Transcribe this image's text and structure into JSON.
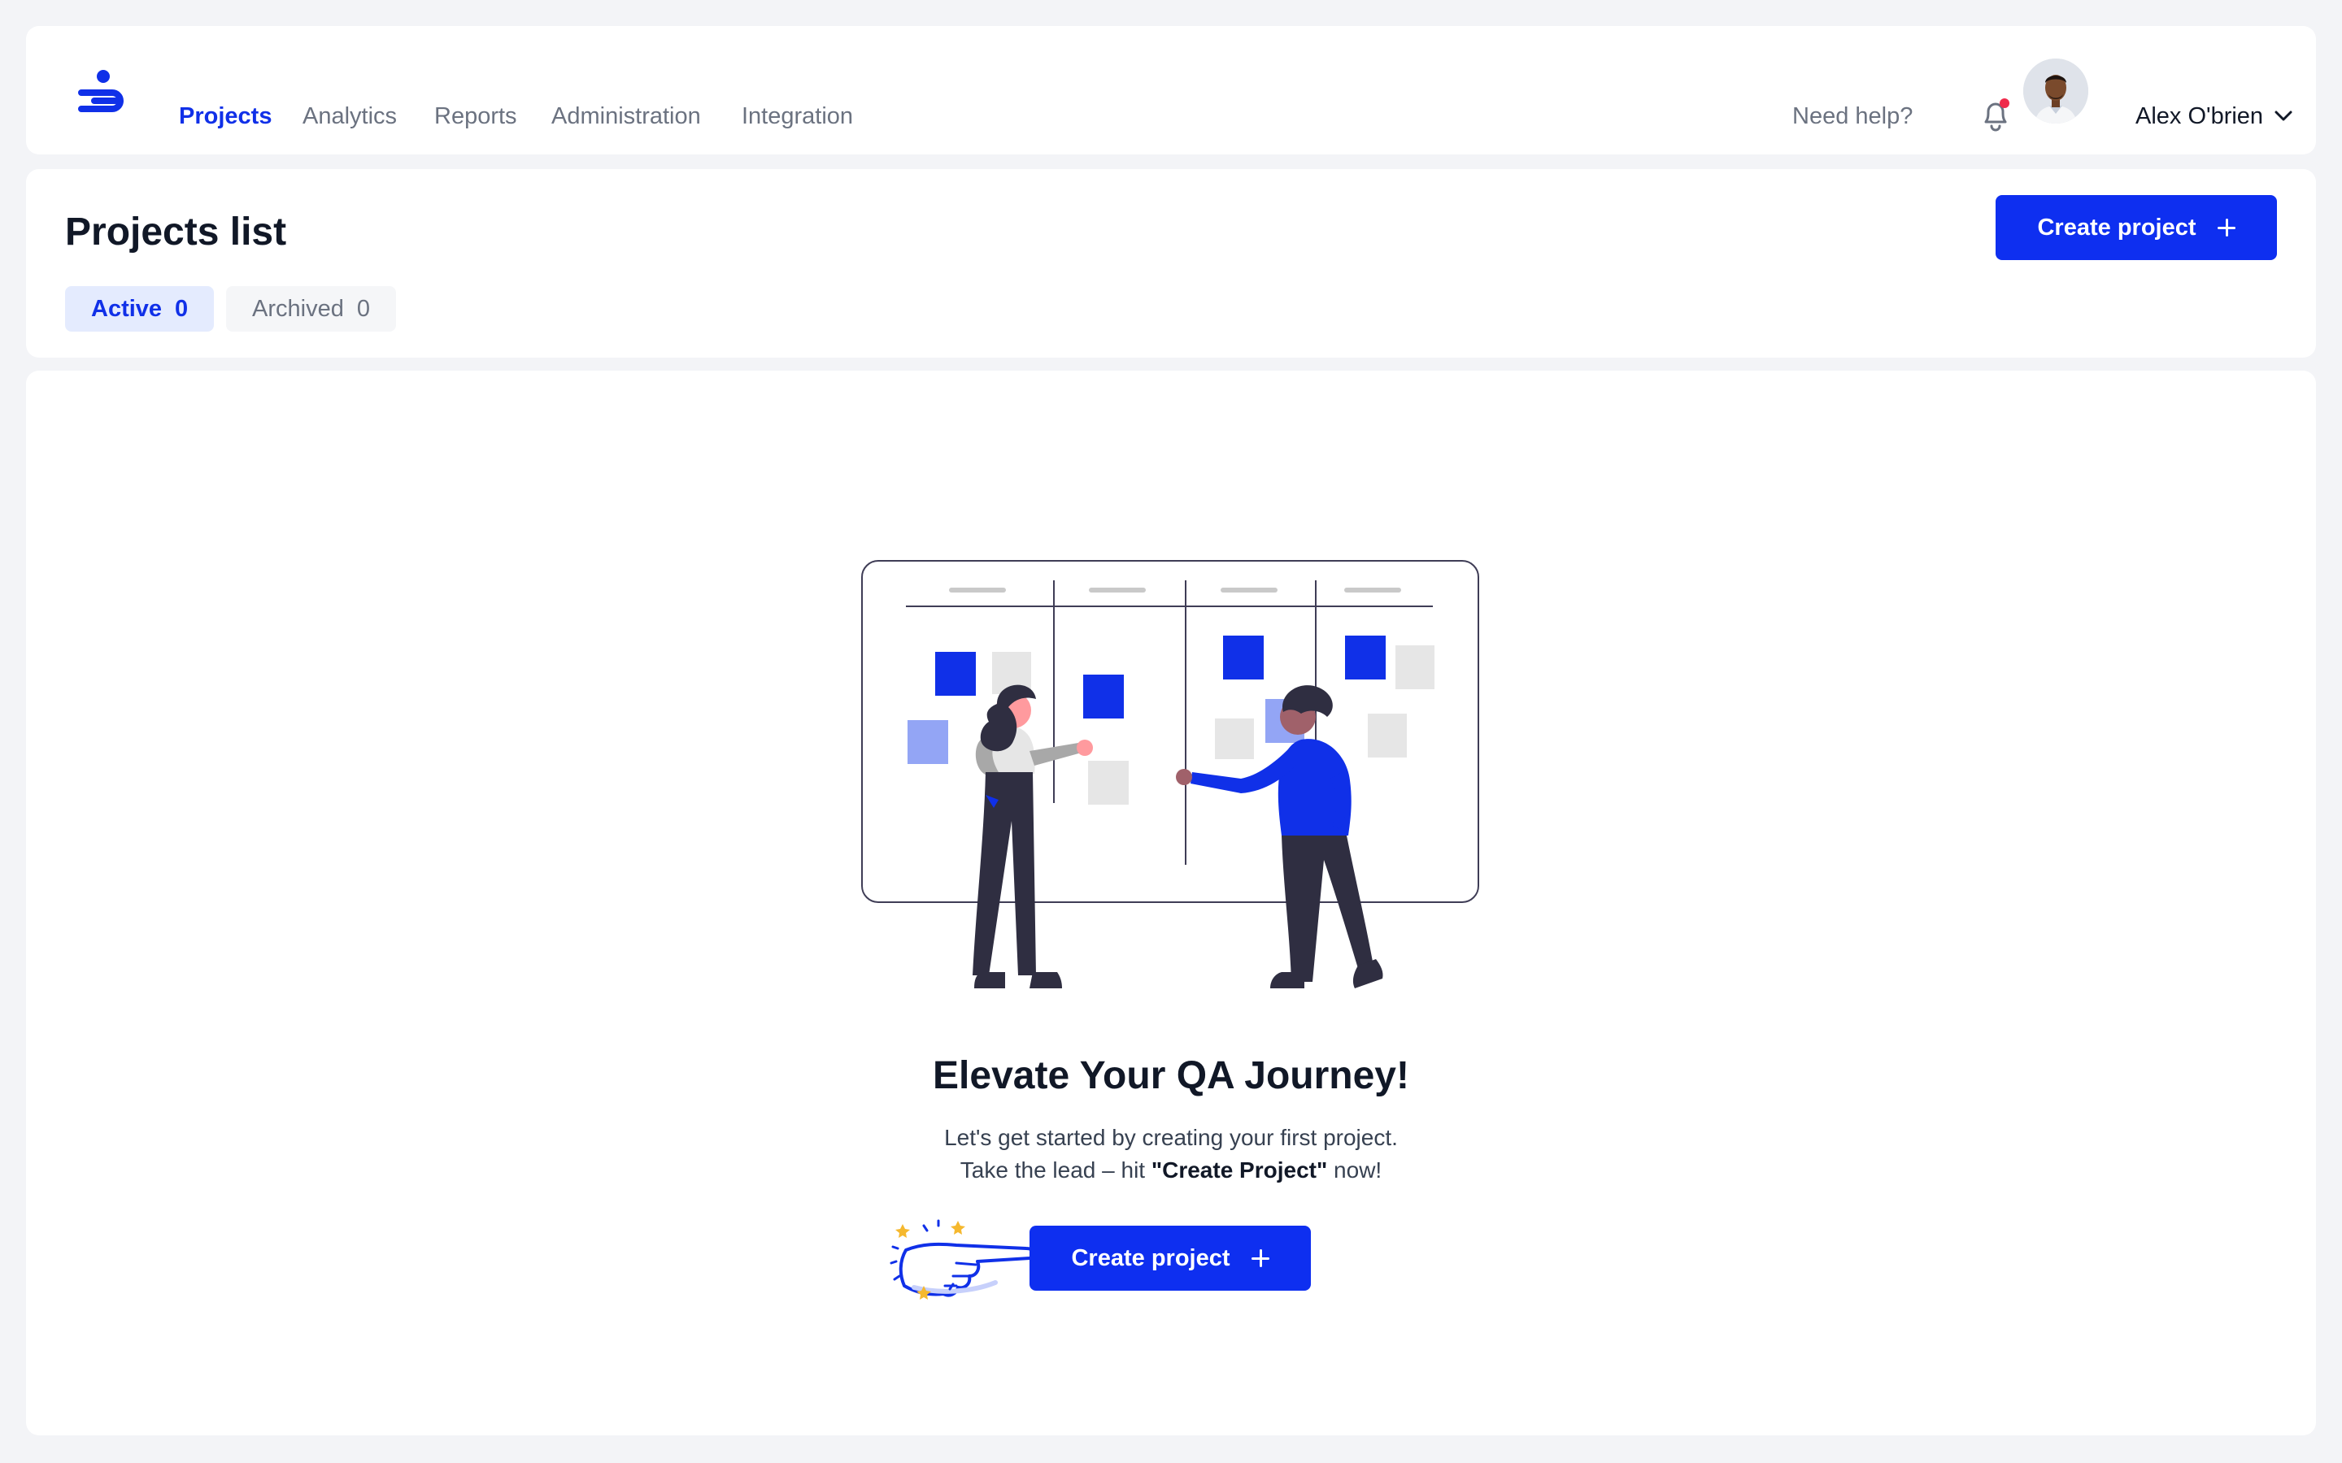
{
  "nav": {
    "items": [
      {
        "label": "Projects",
        "active": true
      },
      {
        "label": "Analytics"
      },
      {
        "label": "Reports"
      },
      {
        "label": "Administration"
      },
      {
        "label": "Integration"
      }
    ],
    "help_label": "Need help?",
    "user_name": "Alex O'brien",
    "logo_icon": "brand-logo-icon",
    "bell_icon": "bell-icon",
    "caret_icon": "chevron-down-icon"
  },
  "header": {
    "title": "Projects list",
    "create_label": "Create project",
    "tabs": [
      {
        "label": "Active",
        "count": "0",
        "selected": true
      },
      {
        "label": "Archived",
        "count": "0"
      }
    ]
  },
  "empty_state": {
    "heading": "Elevate Your QA Journey!",
    "line1": "Let's get started by creating your first project.",
    "line2_prefix": "Take the lead – hit ",
    "line2_bold": "\"Create Project\"",
    "line2_suffix": " now!",
    "create_label": "Create project"
  },
  "colors": {
    "accent": "#0e2ff0",
    "active_tab_bg": "#e4ebfe",
    "notification_dot": "#ef2b4b",
    "background": "#f3f4f7"
  }
}
